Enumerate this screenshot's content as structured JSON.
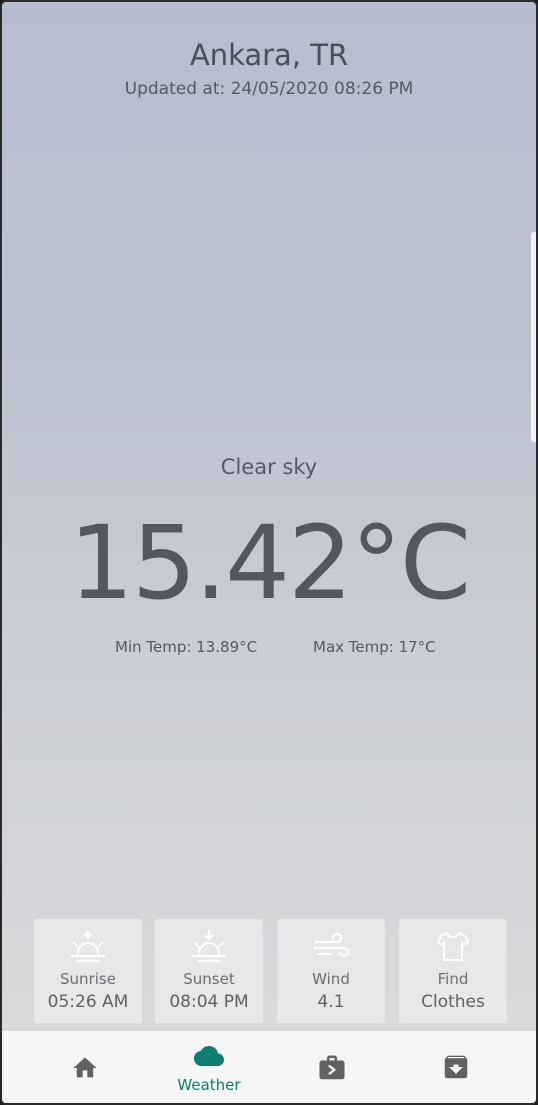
{
  "location": {
    "city": "Ankara, TR",
    "updated": "Updated at: 24/05/2020 08:26 PM"
  },
  "weather": {
    "condition": "Clear sky",
    "temperature": "15.42°C",
    "min_temp": "Min Temp: 13.89°C",
    "max_temp": "Max Temp: 17°C"
  },
  "cards": [
    {
      "icon": "sunrise-icon",
      "label": "Sunrise",
      "value": "05:26 AM"
    },
    {
      "icon": "sunset-icon",
      "label": "Sunset",
      "value": "08:04 PM"
    },
    {
      "icon": "wind-icon",
      "label": "Wind",
      "value": "4.1"
    },
    {
      "icon": "shirt-icon",
      "label": "Find",
      "value": "Clothes"
    }
  ],
  "nav": {
    "items": [
      {
        "icon": "home-icon",
        "label": ""
      },
      {
        "icon": "cloud-icon",
        "label": "Weather",
        "active": true
      },
      {
        "icon": "briefcase-icon",
        "label": ""
      },
      {
        "icon": "archive-icon",
        "label": ""
      }
    ],
    "active_color": "#0f7c72",
    "inactive_color": "#616161"
  }
}
